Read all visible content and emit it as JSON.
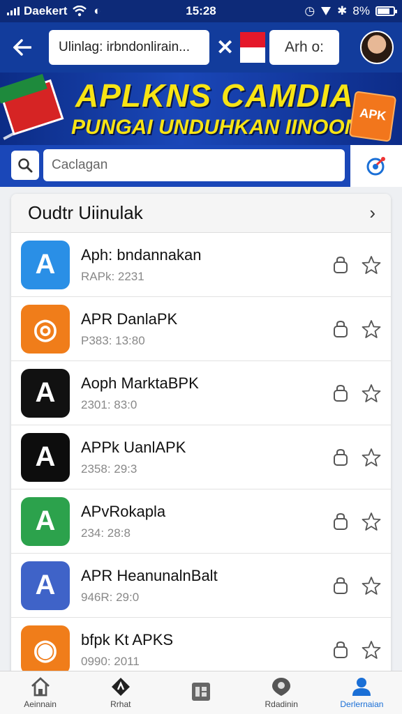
{
  "status_bar": {
    "carrier": "Daekert",
    "time": "15:28",
    "battery": "8%"
  },
  "header": {
    "url": "Ulinlag: irbndonlirain...",
    "apk_label": "Arh o:"
  },
  "banner": {
    "title": "APLKNS CAMDIA",
    "subtitle": "PUNGAI UNDUHKAN IINOONAII",
    "box_label": "APK"
  },
  "search": {
    "placeholder": "Caclagan"
  },
  "list": {
    "title": "Oudtr Uiinulak",
    "items": [
      {
        "name": "Aph: bndannakan",
        "info": "RAPk: 2231",
        "icon_color": "#2a8fe6",
        "icon_glyph": "A"
      },
      {
        "name": "APR DanlaPK",
        "info": "P383: 13:80",
        "icon_color": "#f07d1a",
        "icon_glyph": "◎"
      },
      {
        "name": "Aoph MarktaBPK",
        "info": "2301: 83:0",
        "icon_color": "#111111",
        "icon_glyph": "A"
      },
      {
        "name": "APPk UanlAPK",
        "info": "2358: 29:3",
        "icon_color": "#0d0d0d",
        "icon_glyph": "A"
      },
      {
        "name": "APvRokapla",
        "info": "234: 28:8",
        "icon_color": "#2ca24c",
        "icon_glyph": "A"
      },
      {
        "name": "APR HeanunalnBalt",
        "info": "946R: 29:0",
        "icon_color": "#3f63c8",
        "icon_glyph": "A"
      },
      {
        "name": "bfpk Kt APKS",
        "info": "0990: 2011",
        "icon_color": "#f07d1a",
        "icon_glyph": "◉"
      }
    ]
  },
  "nav": {
    "items": [
      {
        "label": "Aeinnain",
        "icon": "home-icon"
      },
      {
        "label": "Rrhat",
        "icon": "apk-icon"
      },
      {
        "label": "",
        "icon": "grid-icon"
      },
      {
        "label": "Rdadinin",
        "icon": "badge-icon"
      },
      {
        "label": "Derlernaian",
        "icon": "profile-icon"
      }
    ]
  },
  "colors": {
    "primary": "#123c9c",
    "accent": "#f7e414",
    "active_nav": "#1a6fd6"
  }
}
